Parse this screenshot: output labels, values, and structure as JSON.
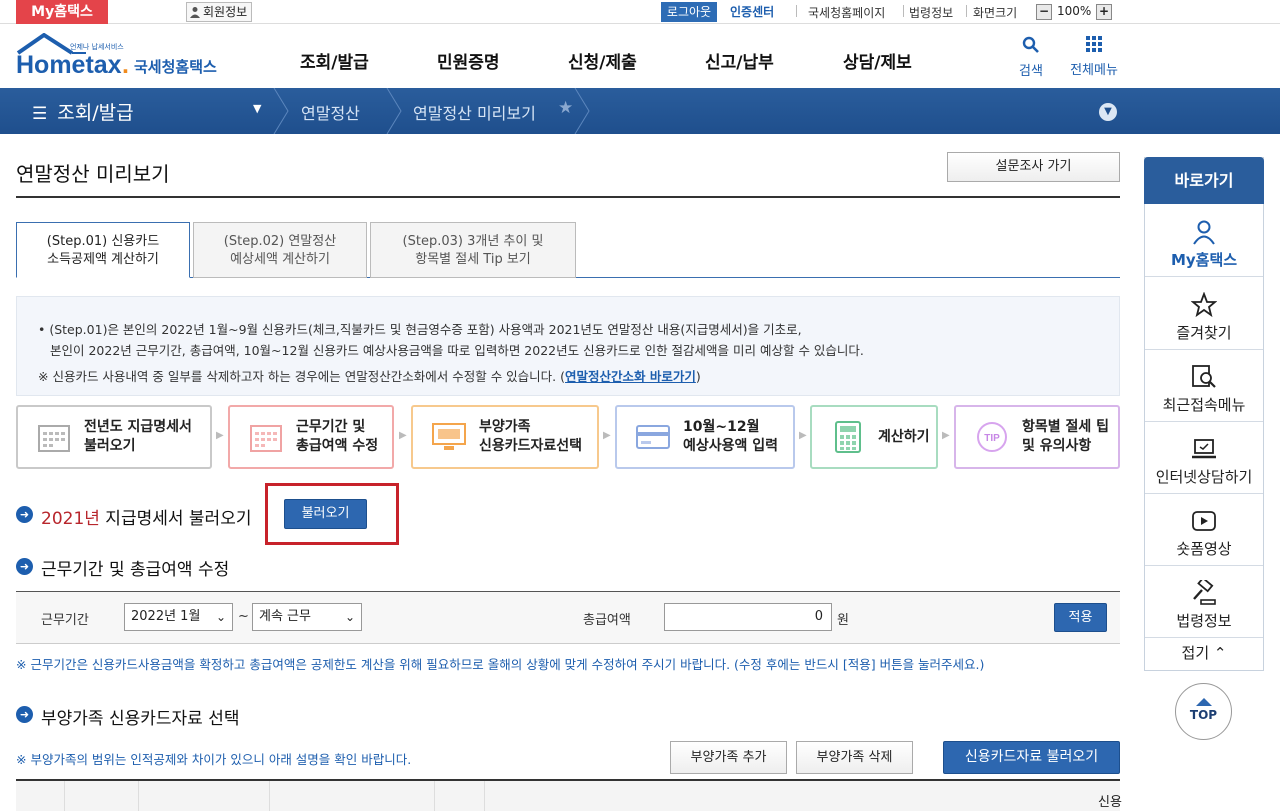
{
  "util": {
    "my_hometax": "My홈택스",
    "member_info": "회원정보",
    "logout": "로그아웃",
    "cert_center": "인증센터",
    "nts_page": "국세청홈페이지",
    "law_info": "법령정보",
    "screen_size": "화면크기",
    "zoom_minus": "−",
    "zoom_value": "100%",
    "zoom_plus": "+"
  },
  "header": {
    "logo_small": "언제나 납세서비스",
    "logo_main": "Hometax",
    "logo_dot": ".",
    "logo_suffix": "국세청홈택스",
    "gnb": [
      "조회/발급",
      "민원증명",
      "신청/제출",
      "신고/납부",
      "상담/제보"
    ],
    "search": "검색",
    "all_menu": "전체메뉴"
  },
  "nav": {
    "menu": "조회/발급",
    "crumb1": "연말정산",
    "crumb2": "연말정산 미리보기"
  },
  "page": {
    "title": "연말정산 미리보기",
    "survey": "설문조사 가기"
  },
  "tabs": [
    {
      "line1": "(Step.01) 신용카드",
      "line2": "소득공제액 계산하기"
    },
    {
      "line1": "(Step.02) 연말정산",
      "line2": "예상세액 계산하기"
    },
    {
      "line1": "(Step.03) 3개년 추이 및",
      "line2": "항목별 절세 Tip 보기"
    }
  ],
  "info": {
    "line1": "• (Step.01)은 본인의 2022년 1월~9월 신용카드(체크,직불카드 및 현금영수증 포함) 사용액과 2021년도 연말정산 내용(지급명세서)을 기초로,",
    "line2": "본인이 2022년 근무기간, 총급여액, 10월~12월 신용카드 예상사용금액을 따로 입력하면 2022년도 신용카드로 인한 절감세액을 미리 예상할 수 있습니다.",
    "line3": "※ 신용카드 사용내역 중 일부를 삭제하고자 하는 경우에는 연말정산간소화에서 수정할 수 있습니다. (",
    "link": "연말정산간소화 바로가기",
    "line3_end": ")"
  },
  "process": [
    {
      "line1": "전년도 지급명세서",
      "line2": "불러오기",
      "color": "#c9c9c9"
    },
    {
      "line1": "근무기간 및",
      "line2": "총급여액 수정",
      "color": "#f2a9a9"
    },
    {
      "line1": "부양가족",
      "line2": "신용카드자료선택",
      "color": "#f7c98d"
    },
    {
      "line1": "10월~12월",
      "line2": "예상사용액 입력",
      "color": "#b9c9ec"
    },
    {
      "line1": "계산하기",
      "line2": "",
      "color": "#a8dcc0"
    },
    {
      "line1": "항목별 절세 팁",
      "line2": "및 유의사항",
      "color": "#d7b5ea"
    }
  ],
  "section1": {
    "year": "2021년",
    "title": " 지급명세서 불러오기",
    "button": "불러오기"
  },
  "section2": {
    "title": "근무기간 및 총급여액 수정",
    "period_label": "근무기간",
    "start": "2022년 1월",
    "tilde": "~",
    "end": "계속 근무",
    "salary_label": "총급여액",
    "amount": "0",
    "won": "원",
    "apply": "적용",
    "note": "※ 근무기간은 신용카드사용금액을 확정하고 총급여액은 공제한도 계산을 위해 필요하므로 올해의 상황에 맞게 수정하여 주시기 바랍니다. (수정 후에는 반드시 [적용] 버튼을 눌러주세요.)"
  },
  "section3": {
    "title": "부양가족 신용카드자료 선택",
    "note": "※ 부양가족의 범위는 인적공제와 차이가 있으니 아래 설명을 확인 바랍니다.",
    "add": "부양가족 추가",
    "delete": "부양가족 삭제",
    "load_card": "신용카드자료 불러오기",
    "table_partial": "신용"
  },
  "quick": {
    "head": "바로가기",
    "items": [
      "My홈택스",
      "즐겨찾기",
      "최근접속메뉴",
      "인터넷상담하기",
      "숏폼영상",
      "법령정보"
    ],
    "fold": "접기",
    "top": "TOP"
  }
}
